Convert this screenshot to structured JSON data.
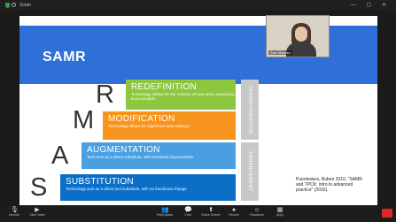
{
  "window": {
    "title": "Zoom"
  },
  "slide": {
    "title": "SAMR",
    "levels": [
      {
        "letter": "R",
        "title": "REDEFINITION",
        "desc": "Technology allows for the creation of new tasks, previously inconceivable",
        "color": "#8dc63f"
      },
      {
        "letter": "M",
        "title": "MODIFICATION",
        "desc": "Technology allows for significant task redesign",
        "color": "#f7941d"
      },
      {
        "letter": "A",
        "title": "AUGMENTATION",
        "desc": "Tech acts as a direct substitute, with functional improvement",
        "color": "#4a9fe0"
      },
      {
        "letter": "S",
        "title": "SUBSTITUTION",
        "desc": "Technology acts as a direct tool substitute, with no functional change",
        "color": "#0b6fc7"
      }
    ],
    "side_tags": [
      "TRANSFORMATION",
      "ENHANCEMENT"
    ],
    "reference": "Puentedura, Ruben 2010, \"SAMR and TPCK: intro to advanced practice\" (2010)."
  },
  "participant": {
    "name": "Sue Shkurko"
  },
  "toolbar": {
    "items": [
      {
        "icon": "microphone-icon",
        "glyph": "🎙",
        "label": "Unmute"
      },
      {
        "icon": "video-icon",
        "glyph": "▶",
        "label": "Start Video"
      },
      {
        "icon": "participants-icon",
        "glyph": "👥",
        "label": "Participants"
      },
      {
        "icon": "chat-icon",
        "glyph": "💬",
        "label": "Chat"
      },
      {
        "icon": "share-screen-icon",
        "glyph": "⬆",
        "label": "Share Screen"
      },
      {
        "icon": "record-icon",
        "glyph": "●",
        "label": "Record"
      },
      {
        "icon": "reactions-icon",
        "glyph": "☺",
        "label": "Reactions"
      },
      {
        "icon": "apps-icon",
        "glyph": "▦",
        "label": "Apps"
      }
    ]
  },
  "colors": {
    "header": "#2e6fd8",
    "side_tag": "#c8c8c8",
    "end_button": "#e02828"
  }
}
